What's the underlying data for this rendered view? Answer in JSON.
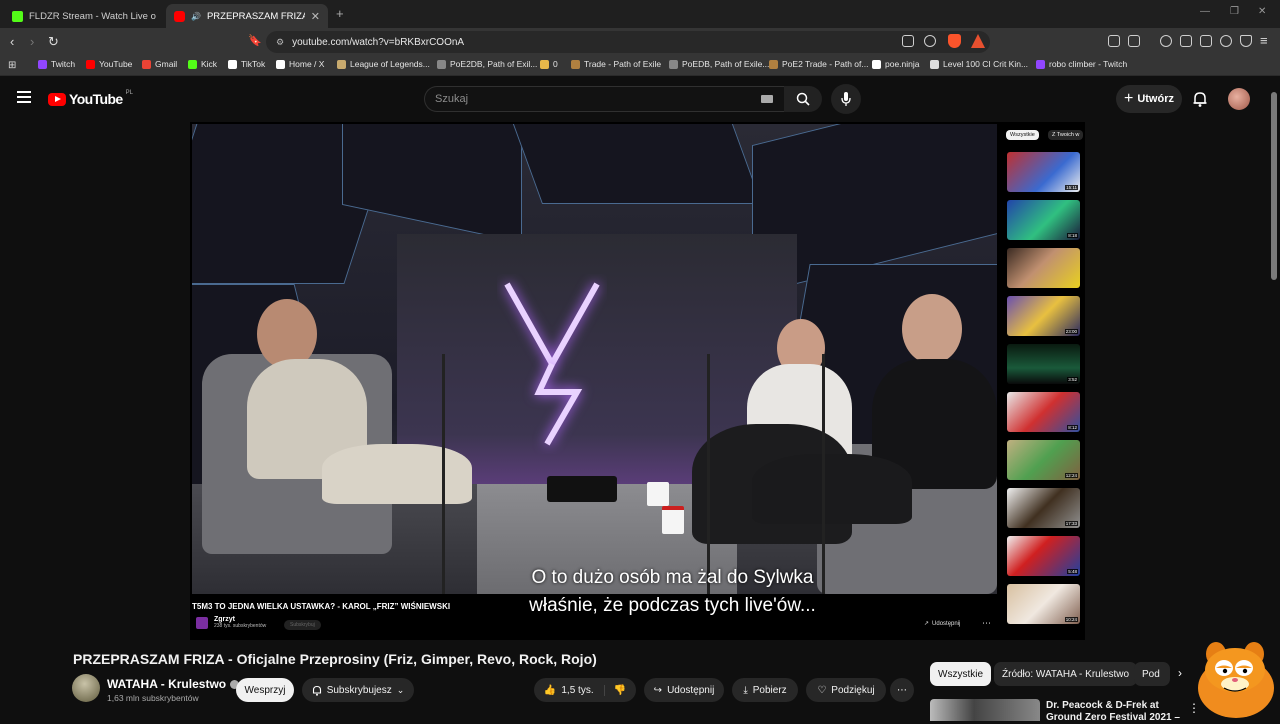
{
  "browser": {
    "tabs": [
      {
        "title": "FLDZR Stream - Watch Live on Kick",
        "color": "#53fc18"
      },
      {
        "title": "PRZEPRASZAM FRIZA - Oficja",
        "color": "#ff0000"
      }
    ],
    "url": "youtube.com/watch?v=bRKBxrCOOnA",
    "bookmarks": [
      {
        "label": "Twitch",
        "color": "#9146ff"
      },
      {
        "label": "YouTube",
        "color": "#ff0000"
      },
      {
        "label": "Gmail",
        "color": "#ea4335"
      },
      {
        "label": "Kick",
        "color": "#53fc18"
      },
      {
        "label": "TikTok",
        "color": "#ffffff"
      },
      {
        "label": "Home / X",
        "color": "#ffffff"
      },
      {
        "label": "League of Legends...",
        "color": "#c8aa6e"
      },
      {
        "label": "PoE2DB, Path of Exil...",
        "color": "#888888"
      },
      {
        "label": "0",
        "color": "#e8b84a"
      },
      {
        "label": "Trade - Path of Exile",
        "color": "#b08040"
      },
      {
        "label": "PoEDB, Path of Exile...",
        "color": "#888888"
      },
      {
        "label": "PoE2 Trade - Path of...",
        "color": "#b08040"
      },
      {
        "label": "poe.ninja",
        "color": "#ffffff"
      },
      {
        "label": "Level 100 CI Crit Kin...",
        "color": "#dddddd"
      },
      {
        "label": "robo climber - Twitch",
        "color": "#9146ff"
      }
    ]
  },
  "header": {
    "logo_text": "YouTube",
    "country_code": "PL",
    "search_placeholder": "Szukaj",
    "create_label": "Utwórz"
  },
  "player": {
    "subtitle_line1": "O to dużo osób ma żal do Sylwka",
    "subtitle_line2": "właśnie, że podczas tych live'ów...",
    "embedded_title": "T5M3 TO JEDNA WIELKA USTAWKA? - KAROL „FRIZ” WIŚNIEWSKI",
    "embedded_channel": "Zgrzyt",
    "embedded_subs": "238 tys. subskrybentów",
    "embedded_subscribe": "Subskrybuj",
    "embedded_share": "Udostępnij",
    "mini_chips": [
      "Wszystkie",
      "Z Twoich w"
    ],
    "mini_durations": [
      "15:11",
      "8:18",
      "",
      "23:00",
      "3:52",
      "8:12",
      "12:24",
      "17:33",
      "5:48",
      "10:24"
    ]
  },
  "video": {
    "title": "PRZEPRASZAM FRIZA - Oficjalne Przeprosiny (Friz, Gimper, Revo, Rock, Rojo)",
    "channel": "WATAHA - Krulestwo",
    "subscribers": "1,63 mln subskrybentów",
    "support_label": "Wesprzyj",
    "subscribed_label": "Subskrybujesz",
    "likes": "1,5 tys.",
    "share_label": "Udostępnij",
    "download_label": "Pobierz",
    "thanks_label": "Podziękuj"
  },
  "sidebar": {
    "chips": [
      "Wszystkie",
      "Źródło: WATAHA - Krulestwo",
      "Pod"
    ],
    "first_video_title": "Dr. Peacock & D-Frek at Ground Zero Festival 2021 –"
  },
  "colors": {
    "yt_red": "#ff0000",
    "background": "#0f0f0f",
    "chip_bg": "#272727",
    "neon_blue": "#3fa9ff",
    "neon_purple": "#b266ff"
  }
}
